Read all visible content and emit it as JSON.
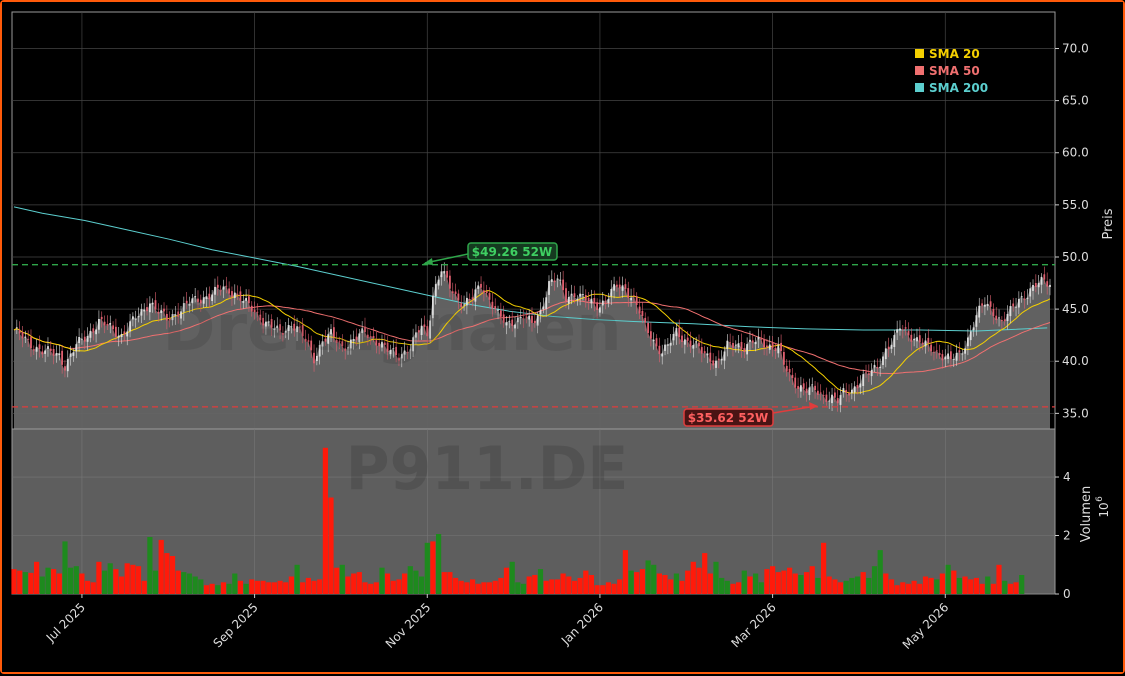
{
  "chart_data": {
    "type": "candlestick",
    "ticker_watermark": "P911.DE",
    "brand_watermark": "Drekagnalen",
    "price_axis": {
      "label": "Preis",
      "ylim": [
        33.5,
        73.5
      ],
      "ticks": [
        "35.0",
        "40.0",
        "45.0",
        "50.0",
        "55.0",
        "60.0",
        "65.0",
        "70.0"
      ]
    },
    "volume_axis": {
      "label": "Volumen",
      "exponent": "10",
      "exponent_power": "6",
      "ylim": [
        0,
        5.3
      ],
      "ticks": [
        "0",
        "2",
        "4"
      ]
    },
    "x_axis": {
      "ticks": [
        "Jul 2025",
        "Sep 2025",
        "Nov 2025",
        "Jan 2026",
        "Mar 2026",
        "May 2026"
      ]
    },
    "legend": {
      "placement": "top-right",
      "items": [
        {
          "label": "SMA 20",
          "color": "#f5d000"
        },
        {
          "label": "SMA 50",
          "color": "#f07070"
        },
        {
          "label": "SMA 200",
          "color": "#5ccfcf"
        }
      ]
    },
    "annotations": {
      "high": {
        "label": "$49.26 52W",
        "value": 49.26,
        "color": "#2fa64a"
      },
      "low": {
        "label": "$35.62 52W",
        "value": 35.62,
        "color": "#e03c3c"
      }
    },
    "sma200": [
      [
        0,
        54.8
      ],
      [
        10,
        54.2
      ],
      [
        25,
        53.5
      ],
      [
        40,
        52.6
      ],
      [
        55,
        51.7
      ],
      [
        70,
        50.7
      ],
      [
        85,
        49.9
      ],
      [
        100,
        49.1
      ],
      [
        115,
        48.2
      ],
      [
        130,
        47.3
      ],
      [
        145,
        46.4
      ],
      [
        160,
        45.5
      ],
      [
        175,
        44.8
      ],
      [
        190,
        44.3
      ],
      [
        205,
        44.0
      ],
      [
        220,
        43.8
      ],
      [
        240,
        43.6
      ],
      [
        260,
        43.3
      ],
      [
        280,
        43.1
      ],
      [
        300,
        43.0
      ],
      [
        320,
        43.0
      ],
      [
        340,
        42.9
      ],
      [
        365,
        43.2
      ]
    ],
    "price_anchors": [
      [
        0,
        43.0
      ],
      [
        5,
        41.8
      ],
      [
        10,
        41.0
      ],
      [
        16,
        40.6
      ],
      [
        18,
        39.6
      ],
      [
        22,
        41.5
      ],
      [
        26,
        42.5
      ],
      [
        30,
        43.8
      ],
      [
        34,
        43.2
      ],
      [
        38,
        42.5
      ],
      [
        42,
        43.8
      ],
      [
        46,
        45.0
      ],
      [
        48,
        45.8
      ],
      [
        50,
        45.0
      ],
      [
        54,
        44.0
      ],
      [
        58,
        44.8
      ],
      [
        62,
        45.6
      ],
      [
        66,
        46.0
      ],
      [
        70,
        46.5
      ],
      [
        74,
        47.0
      ],
      [
        78,
        46.6
      ],
      [
        82,
        45.5
      ],
      [
        86,
        44.5
      ],
      [
        90,
        43.5
      ],
      [
        94,
        42.7
      ],
      [
        98,
        43.6
      ],
      [
        100,
        43.2
      ],
      [
        104,
        41.5
      ],
      [
        106,
        40.3
      ],
      [
        109,
        42.0
      ],
      [
        112,
        42.5
      ],
      [
        116,
        41.4
      ],
      [
        120,
        42.0
      ],
      [
        124,
        42.8
      ],
      [
        128,
        42.0
      ],
      [
        132,
        41.0
      ],
      [
        136,
        40.6
      ],
      [
        140,
        41.3
      ],
      [
        144,
        43.4
      ],
      [
        146,
        42.6
      ],
      [
        148,
        46.4
      ],
      [
        151,
        48.7
      ],
      [
        153,
        47.6
      ],
      [
        156,
        46.3
      ],
      [
        159,
        45.5
      ],
      [
        162,
        46.0
      ],
      [
        165,
        47.4
      ],
      [
        168,
        46.0
      ],
      [
        171,
        44.4
      ],
      [
        174,
        43.5
      ],
      [
        177,
        44.0
      ],
      [
        180,
        44.3
      ],
      [
        183,
        43.5
      ],
      [
        186,
        44.8
      ],
      [
        189,
        47.5
      ],
      [
        192,
        47.8
      ],
      [
        195,
        46.2
      ],
      [
        198,
        46.5
      ],
      [
        201,
        46.0
      ],
      [
        204,
        45.6
      ],
      [
        207,
        45.4
      ],
      [
        210,
        46.2
      ],
      [
        213,
        47.2
      ],
      [
        216,
        47.0
      ],
      [
        219,
        46.0
      ],
      [
        221,
        44.7
      ],
      [
        223,
        43.2
      ],
      [
        225,
        42.5
      ],
      [
        227,
        41.5
      ],
      [
        229,
        40.9
      ],
      [
        231,
        41.4
      ],
      [
        234,
        42.8
      ],
      [
        237,
        42.1
      ],
      [
        240,
        41.6
      ],
      [
        243,
        40.9
      ],
      [
        246,
        40.3
      ],
      [
        249,
        39.9
      ],
      [
        252,
        41.4
      ],
      [
        255,
        41.7
      ],
      [
        258,
        41.4
      ],
      [
        261,
        41.8
      ],
      [
        264,
        41.9
      ],
      [
        267,
        41.5
      ],
      [
        270,
        41.3
      ],
      [
        272,
        39.6
      ],
      [
        274,
        38.6
      ],
      [
        277,
        37.7
      ],
      [
        280,
        37.2
      ],
      [
        283,
        37.2
      ],
      [
        286,
        36.7
      ],
      [
        289,
        36.5
      ],
      [
        291,
        36.1
      ],
      [
        293,
        36.9
      ],
      [
        296,
        37.3
      ],
      [
        299,
        38.1
      ],
      [
        302,
        38.8
      ],
      [
        305,
        39.5
      ],
      [
        308,
        41.1
      ],
      [
        311,
        42.0
      ],
      [
        313,
        43.3
      ],
      [
        316,
        42.7
      ],
      [
        319,
        42.0
      ],
      [
        322,
        41.5
      ],
      [
        325,
        41.1
      ],
      [
        328,
        40.6
      ],
      [
        331,
        40.1
      ],
      [
        334,
        40.6
      ],
      [
        337,
        42.2
      ],
      [
        340,
        44.3
      ],
      [
        343,
        45.6
      ],
      [
        346,
        44.8
      ],
      [
        349,
        43.7
      ],
      [
        352,
        44.7
      ],
      [
        355,
        46.0
      ],
      [
        358,
        46.5
      ],
      [
        361,
        47.2
      ],
      [
        364,
        47.8
      ],
      [
        366,
        47.5
      ]
    ],
    "volume_bars": [
      [
        0,
        0.85,
        0
      ],
      [
        2,
        0.8,
        0
      ],
      [
        4,
        0.75,
        1
      ],
      [
        6,
        0.72,
        0
      ],
      [
        8,
        1.1,
        0
      ],
      [
        10,
        0.6,
        1
      ],
      [
        12,
        0.9,
        1
      ],
      [
        14,
        0.85,
        0
      ],
      [
        16,
        0.7,
        0
      ],
      [
        18,
        1.8,
        1
      ],
      [
        20,
        0.9,
        1
      ],
      [
        22,
        0.95,
        1
      ],
      [
        24,
        0.7,
        0
      ],
      [
        26,
        0.45,
        0
      ],
      [
        28,
        0.4,
        0
      ],
      [
        30,
        1.1,
        0
      ],
      [
        32,
        0.8,
        1
      ],
      [
        34,
        1.05,
        1
      ],
      [
        36,
        0.85,
        0
      ],
      [
        38,
        0.6,
        0
      ],
      [
        40,
        1.05,
        0
      ],
      [
        42,
        1.0,
        0
      ],
      [
        44,
        0.95,
        0
      ],
      [
        46,
        0.45,
        0
      ],
      [
        48,
        1.95,
        1
      ],
      [
        50,
        0.8,
        1
      ],
      [
        52,
        1.85,
        0
      ],
      [
        54,
        1.4,
        0
      ],
      [
        56,
        1.3,
        0
      ],
      [
        58,
        0.8,
        0
      ],
      [
        60,
        0.75,
        1
      ],
      [
        62,
        0.7,
        1
      ],
      [
        64,
        0.6,
        1
      ],
      [
        66,
        0.5,
        1
      ],
      [
        68,
        0.3,
        0
      ],
      [
        70,
        0.35,
        0
      ],
      [
        72,
        0.3,
        1
      ],
      [
        74,
        0.4,
        0
      ],
      [
        76,
        0.35,
        1
      ],
      [
        78,
        0.7,
        1
      ],
      [
        80,
        0.45,
        0
      ],
      [
        82,
        0.35,
        1
      ],
      [
        84,
        0.5,
        0
      ],
      [
        86,
        0.45,
        0
      ],
      [
        88,
        0.45,
        0
      ],
      [
        90,
        0.4,
        0
      ],
      [
        92,
        0.4,
        0
      ],
      [
        94,
        0.45,
        0
      ],
      [
        96,
        0.4,
        0
      ],
      [
        98,
        0.6,
        0
      ],
      [
        100,
        1.0,
        1
      ],
      [
        102,
        0.4,
        0
      ],
      [
        104,
        0.55,
        0
      ],
      [
        106,
        0.45,
        0
      ],
      [
        108,
        0.5,
        0
      ],
      [
        110,
        5.0,
        0
      ],
      [
        112,
        3.3,
        0
      ],
      [
        114,
        0.9,
        0
      ],
      [
        116,
        1.0,
        1
      ],
      [
        118,
        0.6,
        0
      ],
      [
        120,
        0.7,
        0
      ],
      [
        122,
        0.75,
        0
      ],
      [
        124,
        0.4,
        0
      ],
      [
        126,
        0.35,
        0
      ],
      [
        128,
        0.4,
        0
      ],
      [
        130,
        0.9,
        1
      ],
      [
        132,
        0.7,
        0
      ],
      [
        134,
        0.45,
        0
      ],
      [
        136,
        0.5,
        0
      ],
      [
        138,
        0.7,
        0
      ],
      [
        140,
        0.95,
        1
      ],
      [
        142,
        0.8,
        1
      ],
      [
        144,
        0.6,
        1
      ],
      [
        146,
        1.75,
        1
      ],
      [
        148,
        1.8,
        0
      ],
      [
        150,
        2.05,
        1
      ],
      [
        152,
        0.75,
        0
      ],
      [
        154,
        0.75,
        0
      ],
      [
        156,
        0.55,
        0
      ],
      [
        158,
        0.45,
        0
      ],
      [
        160,
        0.4,
        0
      ],
      [
        162,
        0.5,
        0
      ],
      [
        164,
        0.35,
        0
      ],
      [
        166,
        0.4,
        0
      ],
      [
        168,
        0.4,
        0
      ],
      [
        170,
        0.45,
        0
      ],
      [
        172,
        0.55,
        0
      ],
      [
        174,
        0.9,
        0
      ],
      [
        176,
        1.1,
        1
      ],
      [
        178,
        0.4,
        1
      ],
      [
        180,
        0.35,
        1
      ],
      [
        182,
        0.6,
        0
      ],
      [
        184,
        0.65,
        0
      ],
      [
        186,
        0.85,
        1
      ],
      [
        188,
        0.45,
        0
      ],
      [
        190,
        0.5,
        0
      ],
      [
        192,
        0.5,
        0
      ],
      [
        194,
        0.7,
        0
      ],
      [
        196,
        0.6,
        0
      ],
      [
        198,
        0.45,
        0
      ],
      [
        200,
        0.55,
        0
      ],
      [
        202,
        0.8,
        0
      ],
      [
        204,
        0.65,
        0
      ],
      [
        206,
        0.3,
        0
      ],
      [
        208,
        0.3,
        0
      ],
      [
        210,
        0.4,
        0
      ],
      [
        212,
        0.35,
        0
      ],
      [
        214,
        0.5,
        0
      ],
      [
        216,
        1.5,
        0
      ],
      [
        218,
        0.8,
        1
      ],
      [
        220,
        0.75,
        0
      ],
      [
        222,
        0.85,
        0
      ],
      [
        224,
        1.15,
        1
      ],
      [
        226,
        1.0,
        1
      ],
      [
        228,
        0.7,
        0
      ],
      [
        230,
        0.65,
        0
      ],
      [
        232,
        0.5,
        0
      ],
      [
        234,
        0.7,
        1
      ],
      [
        236,
        0.45,
        0
      ],
      [
        238,
        0.8,
        0
      ],
      [
        240,
        1.1,
        0
      ],
      [
        242,
        0.9,
        0
      ],
      [
        244,
        1.4,
        0
      ],
      [
        246,
        0.7,
        0
      ],
      [
        248,
        1.1,
        1
      ],
      [
        250,
        0.55,
        1
      ],
      [
        252,
        0.45,
        1
      ],
      [
        254,
        0.35,
        0
      ],
      [
        256,
        0.4,
        0
      ],
      [
        258,
        0.8,
        1
      ],
      [
        260,
        0.6,
        0
      ],
      [
        262,
        0.7,
        1
      ],
      [
        264,
        0.4,
        1
      ],
      [
        266,
        0.85,
        0
      ],
      [
        268,
        0.95,
        0
      ],
      [
        270,
        0.75,
        0
      ],
      [
        272,
        0.8,
        0
      ],
      [
        274,
        0.9,
        0
      ],
      [
        276,
        0.7,
        0
      ],
      [
        278,
        0.65,
        1
      ],
      [
        280,
        0.75,
        0
      ],
      [
        282,
        0.95,
        0
      ],
      [
        284,
        0.55,
        1
      ],
      [
        286,
        1.75,
        0
      ],
      [
        288,
        0.6,
        0
      ],
      [
        290,
        0.5,
        0
      ],
      [
        292,
        0.4,
        0
      ],
      [
        294,
        0.45,
        1
      ],
      [
        296,
        0.55,
        1
      ],
      [
        298,
        0.6,
        1
      ],
      [
        300,
        0.75,
        0
      ],
      [
        302,
        0.55,
        1
      ],
      [
        304,
        0.95,
        1
      ],
      [
        306,
        1.5,
        1
      ],
      [
        308,
        0.7,
        0
      ],
      [
        310,
        0.5,
        0
      ],
      [
        312,
        0.3,
        0
      ],
      [
        314,
        0.4,
        0
      ],
      [
        316,
        0.35,
        0
      ],
      [
        318,
        0.45,
        0
      ],
      [
        320,
        0.35,
        0
      ],
      [
        322,
        0.6,
        0
      ],
      [
        324,
        0.55,
        0
      ],
      [
        326,
        0.5,
        1
      ],
      [
        328,
        0.7,
        0
      ],
      [
        330,
        1.0,
        1
      ],
      [
        332,
        0.8,
        0
      ],
      [
        334,
        0.55,
        1
      ],
      [
        336,
        0.6,
        0
      ],
      [
        338,
        0.5,
        0
      ],
      [
        340,
        0.55,
        0
      ],
      [
        342,
        0.35,
        0
      ],
      [
        344,
        0.6,
        1
      ],
      [
        346,
        0.35,
        0
      ],
      [
        348,
        1.0,
        0
      ],
      [
        350,
        0.45,
        1
      ],
      [
        352,
        0.35,
        0
      ],
      [
        354,
        0.4,
        0
      ],
      [
        356,
        0.65,
        1
      ]
    ]
  }
}
